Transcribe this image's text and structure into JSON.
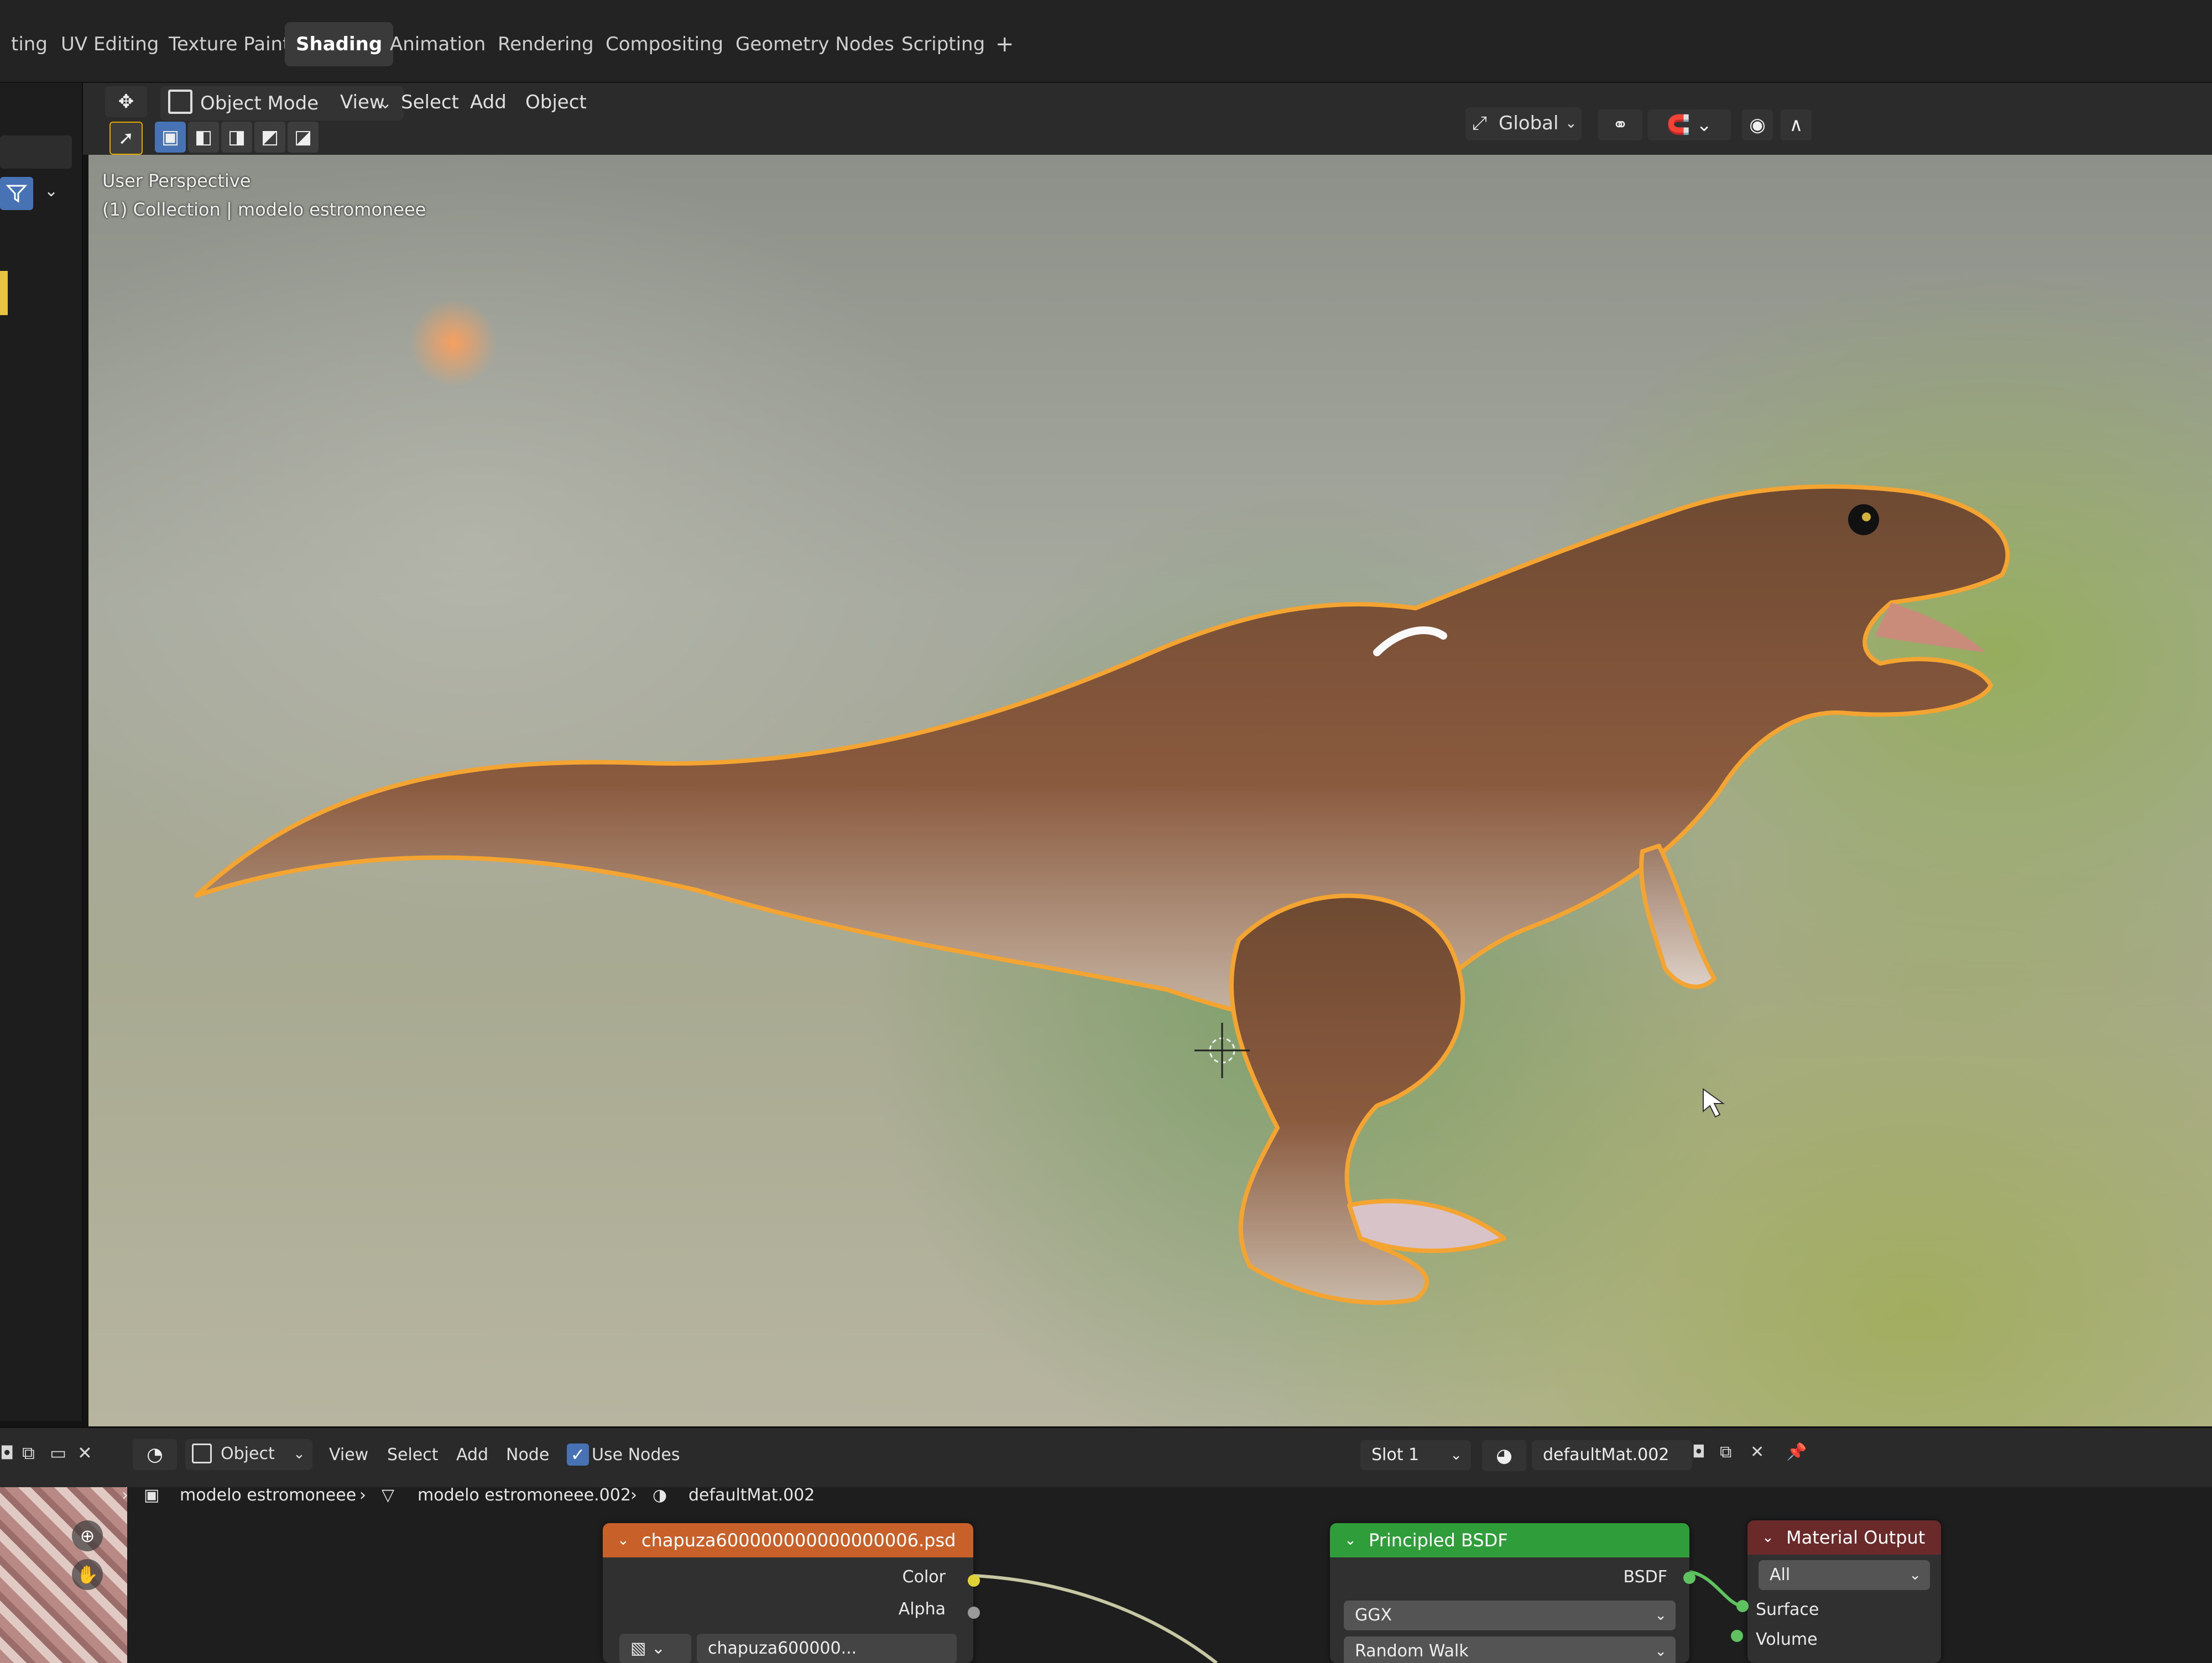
{
  "workspace_tabs": [
    "ting",
    "UV Editing",
    "Texture Paint",
    "Shading",
    "Animation",
    "Rendering",
    "Compositing",
    "Geometry Nodes",
    "Scripting",
    "+"
  ],
  "active_tab": "Shading",
  "viewport_header": {
    "mode": "Object Mode",
    "menus": [
      "View",
      "Select",
      "Add",
      "Object"
    ],
    "transform_orientation": "Global"
  },
  "viewport": {
    "perspective_label": "User Perspective",
    "collection_label": "(1) Collection | modelo estromoneee"
  },
  "node_editor_header": {
    "editor_mode": "Object",
    "menus": [
      "View",
      "Select",
      "Add",
      "Node"
    ],
    "use_nodes_label": "Use Nodes",
    "use_nodes_checked": true,
    "slot": "Slot 1",
    "material_name": "defaultMat.002"
  },
  "breadcrumbs": [
    "modelo estromoneee",
    "modelo estromoneee.002",
    "defaultMat.002"
  ],
  "nodes": {
    "image_texture": {
      "title": "chapuza600000000000000006.psd",
      "outputs": [
        "Color",
        "Alpha"
      ],
      "image_field": "chapuza600000...",
      "header_color": "#c8602a"
    },
    "principled": {
      "title": "Principled BSDF",
      "output": "BSDF",
      "distribution": "GGX",
      "subsurface_method": "Random Walk",
      "header_color": "#2f9e3a"
    },
    "material_output": {
      "title": "Material Output",
      "target": "All",
      "inputs": [
        "Surface",
        "Volume"
      ],
      "header_color": "#6b2a2a"
    }
  },
  "icons": [
    "editor-type-icon",
    "object-mode-icon",
    "select-box-icon",
    "global-orientation-icon",
    "snap-icon",
    "proportional-edit-icon",
    "filter-icon",
    "material-sphere-icon",
    "fake-user-shield-icon",
    "duplicate-icon",
    "close-icon",
    "pin-icon",
    "mesh-data-icon",
    "object-data-icon",
    "zoom-icon",
    "hand-pan-icon",
    "mouse-cursor-icon",
    "3d-cursor-icon"
  ]
}
